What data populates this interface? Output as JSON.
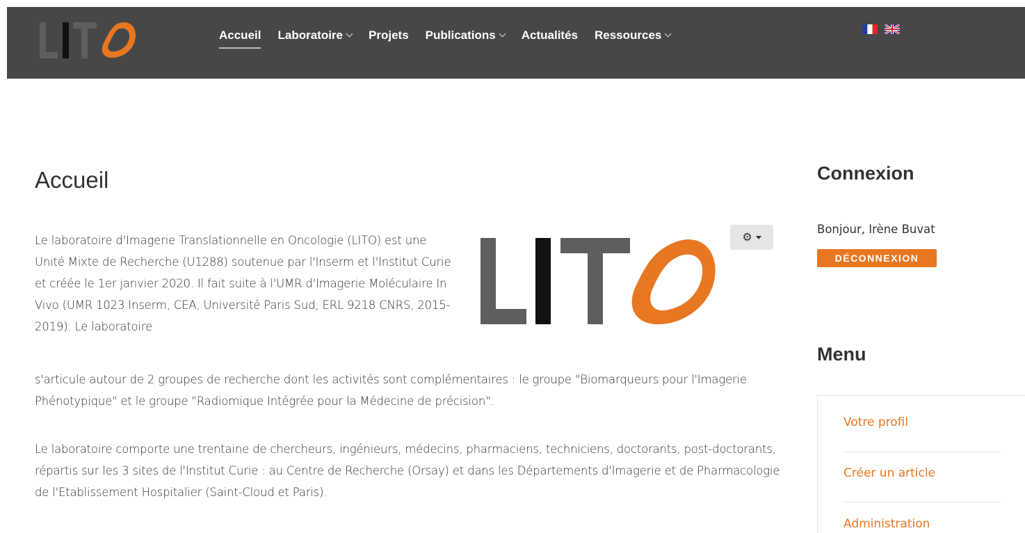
{
  "header": {
    "logo_text": "LITO",
    "nav": [
      {
        "label": "Accueil",
        "active": true,
        "dropdown": false
      },
      {
        "label": "Laboratoire",
        "active": false,
        "dropdown": true
      },
      {
        "label": "Projets",
        "active": false,
        "dropdown": false
      },
      {
        "label": "Publications",
        "active": false,
        "dropdown": true
      },
      {
        "label": "Actualités",
        "active": false,
        "dropdown": false
      },
      {
        "label": "Ressources",
        "active": false,
        "dropdown": true
      }
    ],
    "languages": [
      "fr-flag-icon",
      "uk-flag-icon"
    ]
  },
  "main": {
    "title": "Accueil",
    "paragraph1_top": "Le laboratoire d'Imagerie Translationnelle en Oncologie (LITO) est une Unité Mixte de Recherche (U1288) soutenue par l'Inserm et l'Institut Curie et créée le 1er janvier 2020. Il fait suite à l'UMR d'Imagerie Moléculaire In Vivo (UMR 1023 Inserm, CEA, Université Paris Sud, ERL 9218 CNRS, 2015-2019). Le laboratoire",
    "paragraph1_bottom": "s'articule autour de 2 groupes de recherche dont les activités sont complémentaires : le groupe \"Biomarqueurs pour l'Imagerie Phénotypique\" et le groupe \"Radiomique Intégrée pour la Médecine de précision\".",
    "paragraph2": "Le laboratoire comporte une trentaine de chercheurs, ingénieurs, médecins, pharmaciens, techniciens, doctorants, post-doctorants, répartis sur les 3 sites de l'Institut Curie : au Centre de Recherche (Orsay) et dans les Départements d'Imagerie et de Pharmacologie de l'Etablissement Hospitalier (Saint-Cloud et Paris).",
    "content_logo_text": "LITO",
    "tools_icon": "gear-icon"
  },
  "sidebar": {
    "login_heading": "Connexion",
    "greeting": "Bonjour, Irène Buvat",
    "logout_label": "DÉCONNEXION",
    "menu_heading": "Menu",
    "menu_items": [
      "Votre profil",
      "Créer un article",
      "Administration"
    ]
  },
  "colors": {
    "header_bg": "#474747",
    "accent": "#e87722",
    "logo_gray": "#5e5e5e",
    "logo_black": "#111111"
  }
}
